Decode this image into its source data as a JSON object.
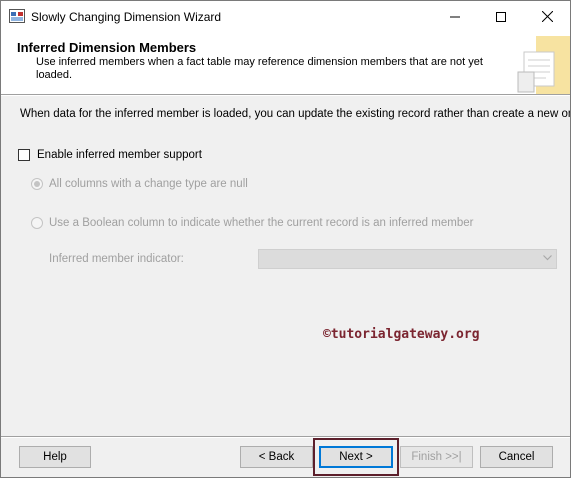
{
  "window": {
    "title": "Slowly Changing Dimension Wizard"
  },
  "header": {
    "title": "Inferred Dimension Members",
    "subtitle": "Use inferred members when a fact table may reference dimension members that are not yet loaded."
  },
  "body": {
    "description": "When data for the inferred member is loaded, you can update the existing record rather than create a new one.",
    "enable_checkbox": {
      "label": "Enable inferred member support",
      "checked": false
    },
    "radio_null": {
      "label": "All columns with a change type are null",
      "selected": true,
      "enabled": false
    },
    "radio_boolean": {
      "label": "Use a Boolean column to indicate whether the current record is an inferred member",
      "selected": false,
      "enabled": false
    },
    "indicator": {
      "label": "Inferred member indicator:",
      "value": ""
    }
  },
  "watermark": "©tutorialgateway.org",
  "footer": {
    "help": "Help",
    "back": "< Back",
    "next": "Next >",
    "finish": "Finish >>|",
    "cancel": "Cancel"
  },
  "colors": {
    "highlight": "#5c1f2b",
    "default_button_border": "#0078d7",
    "disabled_text": "#a0a0a0"
  }
}
